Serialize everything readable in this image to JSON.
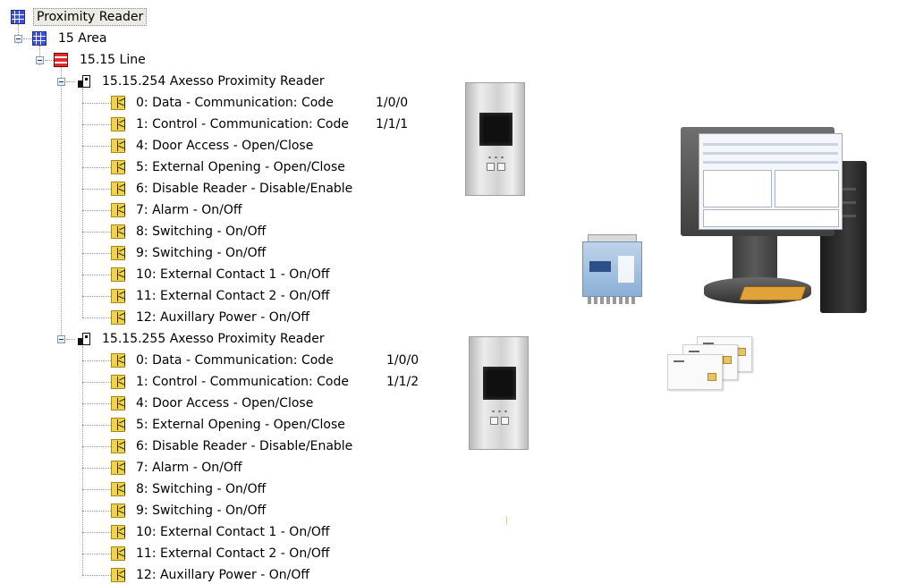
{
  "tree": {
    "root": {
      "label": "Proximity Reader",
      "icon": "grid-icon"
    },
    "area": {
      "label": "15 Area",
      "icon": "grid-icon"
    },
    "line": {
      "label": "15.15 Line",
      "icon": "line-icon"
    },
    "devices": [
      {
        "label": "15.15.254 Axesso Proximity Reader",
        "objects": [
          {
            "label": "0: Data - Communication: Code",
            "ga": "1/0/0"
          },
          {
            "label": "1: Control - Communication: Code",
            "ga": "1/1/1"
          },
          {
            "label": "4: Door Access - Open/Close",
            "ga": ""
          },
          {
            "label": "5: External Opening - Open/Close",
            "ga": ""
          },
          {
            "label": "6: Disable Reader - Disable/Enable",
            "ga": ""
          },
          {
            "label": "7: Alarm - On/Off",
            "ga": ""
          },
          {
            "label": "8: Switching - On/Off",
            "ga": ""
          },
          {
            "label": "9: Switching - On/Off",
            "ga": ""
          },
          {
            "label": "10: External Contact 1 - On/Off",
            "ga": ""
          },
          {
            "label": "11: External Contact 2 - On/Off",
            "ga": ""
          },
          {
            "label": "12: Auxillary Power - On/Off",
            "ga": ""
          }
        ]
      },
      {
        "label": "15.15.255 Axesso Proximity Reader",
        "objects": [
          {
            "label": "0: Data - Communication: Code",
            "ga": "1/0/0"
          },
          {
            "label": "1: Control - Communication: Code",
            "ga": "1/1/2"
          },
          {
            "label": "4: Door Access - Open/Close",
            "ga": ""
          },
          {
            "label": "5: External Opening - Open/Close",
            "ga": ""
          },
          {
            "label": "6: Disable Reader - Disable/Enable",
            "ga": ""
          },
          {
            "label": "7: Alarm - On/Off",
            "ga": ""
          },
          {
            "label": "8: Switching - On/Off",
            "ga": ""
          },
          {
            "label": "9: Switching - On/Off",
            "ga": ""
          },
          {
            "label": "10: External Contact 1 - On/Off",
            "ga": ""
          },
          {
            "label": "11: External Contact 2 - On/Off",
            "ga": ""
          },
          {
            "label": "12: Auxillary Power - On/Off",
            "ga": ""
          }
        ]
      }
    ]
  },
  "colors": {
    "grid_icon": "#3d50d0",
    "line_icon": "#e22b2b",
    "object_icon": "#eed34a",
    "selection_bg": "#ebeae3"
  },
  "icons": {
    "device": "device-icon",
    "object": "communication-object-icon",
    "expander": "collapse-icon"
  }
}
